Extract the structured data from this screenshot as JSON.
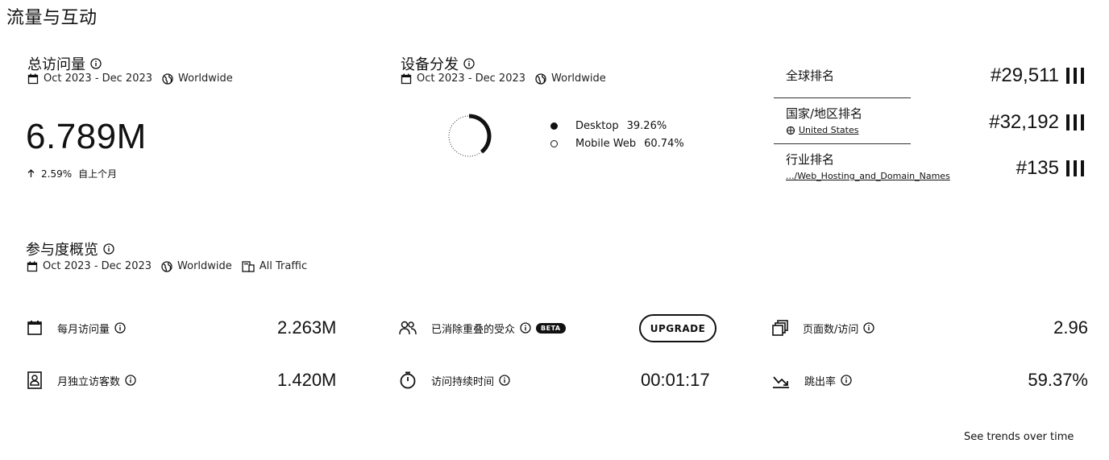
{
  "page_title": "流量与互动",
  "total_visits": {
    "title": "总访问量",
    "date_range": "Oct 2023 - Dec 2023",
    "region": "Worldwide",
    "value": "6.789M",
    "change": "2.59%",
    "change_direction": "up",
    "change_label": "自上个月"
  },
  "device_distribution": {
    "title": "设备分发",
    "date_range": "Oct 2023 - Dec 2023",
    "region": "Worldwide",
    "items": [
      {
        "name": "Desktop",
        "value": "39.26%",
        "fraction": 0.3926,
        "color": "#111111",
        "filled": true
      },
      {
        "name": "Mobile Web",
        "value": "60.74%",
        "fraction": 0.6074,
        "color": "#ffffff",
        "filled": false
      }
    ]
  },
  "rankings": [
    {
      "label": "全球排名",
      "sub": "",
      "value": "#29,511"
    },
    {
      "label": "国家/地区排名",
      "sub": "United States",
      "value": "#32,192"
    },
    {
      "label": "行业排名",
      "sub": ".../Web_Hosting_and_Domain_Names",
      "value": "#135"
    }
  ],
  "engagement": {
    "title": "参与度概览",
    "date_range": "Oct 2023 - Dec 2023",
    "region": "Worldwide",
    "traffic": "All Traffic",
    "metrics": {
      "monthly_visits": {
        "label": "每月访问量",
        "value": "2.263M",
        "icon": "calendar-icon"
      },
      "dedup_audience": {
        "label": "已消除重叠的受众",
        "badge": "BETA",
        "button": "UPGRADE",
        "icon": "people-icon"
      },
      "pages_per_visit": {
        "label": "页面数/访问",
        "value": "2.96",
        "icon": "pages-icon"
      },
      "unique_visitors": {
        "label": "月独立访客数",
        "value": "1.420M",
        "icon": "visitor-icon"
      },
      "visit_duration": {
        "label": "访问持续时间",
        "value": "00:01:17",
        "icon": "stopwatch-icon"
      },
      "bounce_rate": {
        "label": "跳出率",
        "value": "59.37%",
        "icon": "trend-icon"
      }
    }
  },
  "see_trends": "See trends over time"
}
